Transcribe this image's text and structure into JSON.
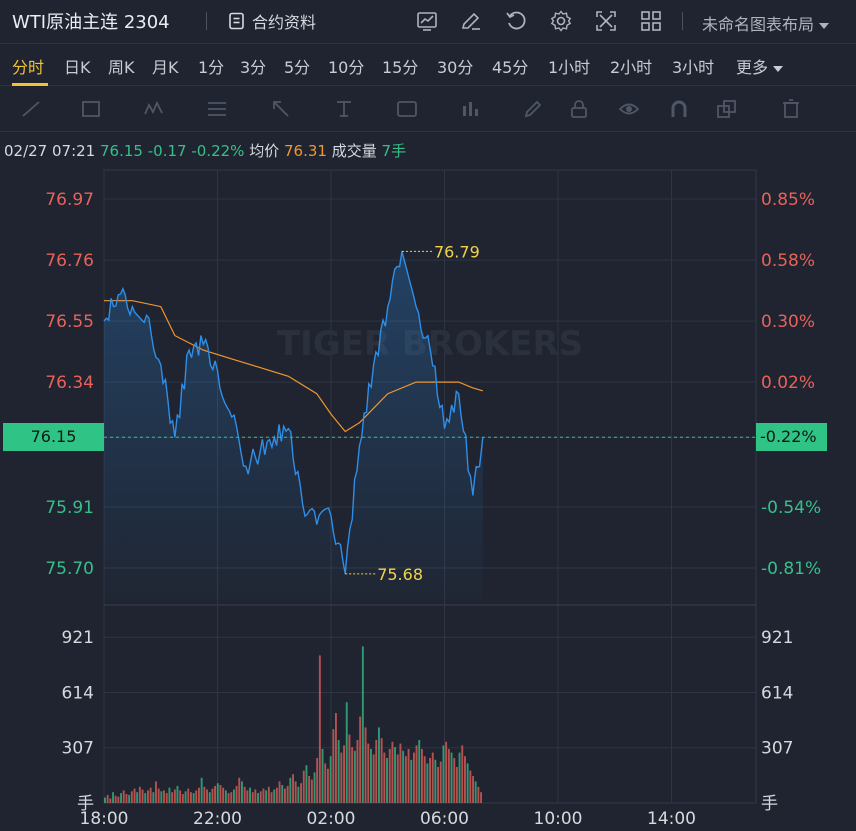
{
  "header": {
    "title": "WTI原油主连 2304",
    "info_label": "合约资料",
    "layout_name": "未命名图表布局",
    "icons": [
      "chart-icon",
      "edit-icon",
      "refresh-icon",
      "settings-icon",
      "fullscreen-icon",
      "layout-grid-icon"
    ]
  },
  "tabs": [
    "分时",
    "日K",
    "周K",
    "月K",
    "1分",
    "3分",
    "5分",
    "10分",
    "15分",
    "30分",
    "45分",
    "1小时",
    "2小时",
    "3小时",
    "更多"
  ],
  "active_tab": "分时",
  "drawing_tools": [
    "line-tool-icon",
    "rectangle-tool-icon",
    "pattern-tool-icon",
    "fib-tool-icon",
    "arrow-tool-icon",
    "measure-tool-icon",
    "text-tool-icon",
    "indicator-tool-icon",
    "pen-icon",
    "lock-icon",
    "eye-icon",
    "magnet-icon",
    "copy-icon",
    "trash-icon"
  ],
  "quote": {
    "time": "02/27 07:21",
    "price": "76.15",
    "change": "-0.17",
    "change_pct": "-0.22%",
    "avg_label": "均价",
    "avg_value": "76.31",
    "volume_label": "成交量",
    "volume_value": "7手"
  },
  "watermark": "TIGER BROKERS",
  "colors": {
    "up": "#e8625a",
    "down": "#35c08a",
    "price_line": "#2e8ee8",
    "avg_line": "#f0962e",
    "highlight": "#f1d34a",
    "current_tag": "#2fc386"
  },
  "chart_data": {
    "type": "line",
    "x_ticks": [
      "18:00",
      "22:00",
      "02:00",
      "06:00",
      "10:00",
      "14:00"
    ],
    "price_axis": {
      "ylim": [
        75.59,
        77.07
      ],
      "left_ticks": [
        "76.97",
        "76.76",
        "76.55",
        "76.34",
        "76.15",
        "75.91",
        "75.70"
      ],
      "right_ticks": [
        "0.85%",
        "0.58%",
        "0.30%",
        "0.02%",
        "-0.22%",
        "-0.54%",
        "-0.81%"
      ]
    },
    "current_price": "76.15",
    "current_pct": "-0.22%",
    "high_label": "76.79",
    "low_label": "75.68",
    "series": [
      {
        "name": "价格",
        "x": [
          "18:00",
          "18:30",
          "19:00",
          "19:30",
          "20:00",
          "20:30",
          "21:00",
          "21:30",
          "22:00",
          "22:30",
          "23:00",
          "23:30",
          "00:00",
          "00:30",
          "01:00",
          "01:30",
          "02:00",
          "02:30",
          "03:00",
          "03:30",
          "04:00",
          "04:30",
          "05:00",
          "05:30",
          "06:00",
          "06:30",
          "07:00",
          "07:21"
        ],
        "values": [
          76.55,
          76.64,
          76.6,
          76.57,
          76.4,
          76.15,
          76.45,
          76.47,
          76.38,
          76.22,
          76.05,
          76.1,
          76.15,
          76.18,
          75.92,
          75.85,
          75.88,
          75.68,
          76.12,
          76.4,
          76.6,
          76.79,
          76.6,
          76.45,
          76.18,
          76.3,
          75.95,
          76.15
        ]
      },
      {
        "name": "均价",
        "x": [
          "18:00",
          "19:00",
          "20:00",
          "20:30",
          "21:30",
          "22:30",
          "23:30",
          "00:30",
          "01:30",
          "02:00",
          "02:30",
          "03:00",
          "04:00",
          "05:00",
          "06:00",
          "06:30",
          "07:00",
          "07:21"
        ],
        "values": [
          76.62,
          76.62,
          76.6,
          76.5,
          76.45,
          76.42,
          76.39,
          76.36,
          76.3,
          76.23,
          76.17,
          76.2,
          76.3,
          76.34,
          76.34,
          76.34,
          76.32,
          76.31
        ]
      }
    ],
    "volume_axis": {
      "ylim": [
        0,
        1100
      ],
      "ticks": [
        "921",
        "614",
        "307"
      ],
      "unit": "手"
    },
    "volume": [
      30,
      45,
      25,
      60,
      40,
      35,
      55,
      70,
      50,
      45,
      65,
      80,
      60,
      90,
      75,
      55,
      70,
      85,
      60,
      120,
      80,
      65,
      70,
      55,
      85,
      60,
      75,
      95,
      70,
      50,
      65,
      80,
      60,
      55,
      70,
      85,
      140,
      90,
      75,
      60,
      80,
      95,
      110,
      100,
      85,
      70,
      55,
      60,
      75,
      95,
      140,
      120,
      90,
      70,
      85,
      60,
      75,
      55,
      65,
      80,
      70,
      90,
      60,
      75,
      85,
      120,
      100,
      80,
      95,
      140,
      160,
      120,
      90,
      110,
      180,
      210,
      150,
      130,
      170,
      250,
      820,
      300,
      220,
      190,
      260,
      410,
      500,
      350,
      280,
      320,
      560,
      380,
      310,
      290,
      350,
      480,
      870,
      420,
      330,
      300,
      270,
      350,
      420,
      360,
      280,
      250,
      300,
      340,
      310,
      270,
      330,
      290,
      260,
      300,
      240,
      280,
      320,
      350,
      300,
      260,
      220,
      250,
      280,
      240,
      200,
      230,
      320,
      340,
      300,
      280,
      250,
      200,
      280,
      320,
      260,
      220,
      180,
      150,
      120,
      90,
      60
    ]
  }
}
